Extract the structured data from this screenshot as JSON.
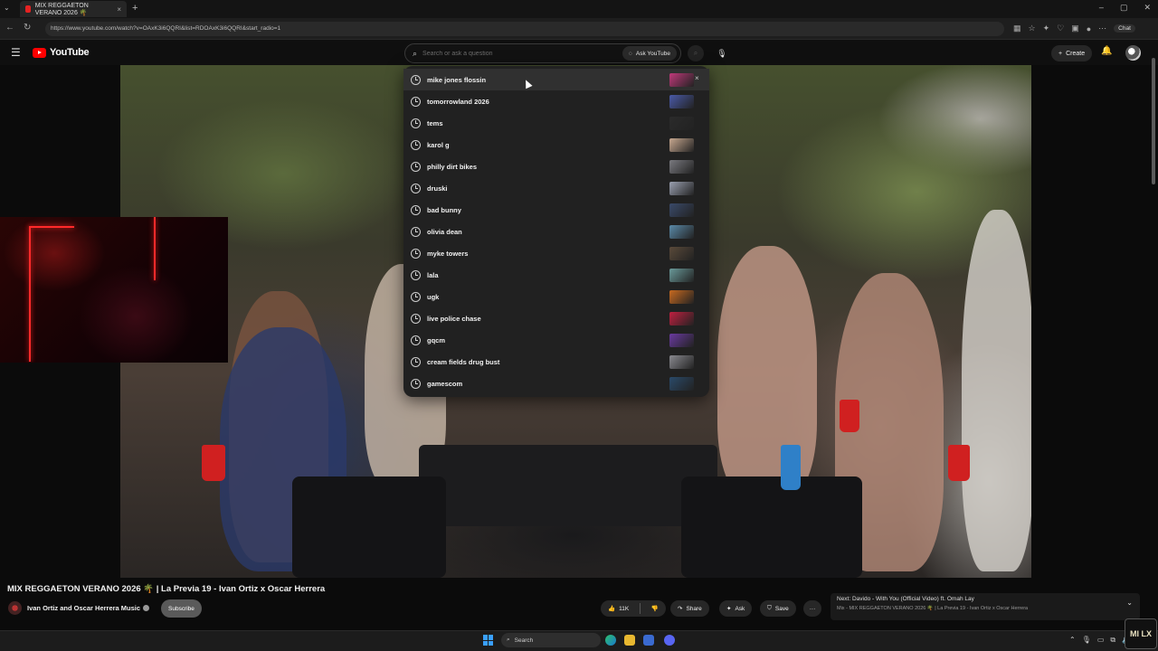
{
  "browser": {
    "tab_title": "MIX REGGAETON VERANO 2026 🌴",
    "tab_close": "×",
    "new_tab": "+",
    "url": "https://www.youtube.com/watch?v=OAxK3i6QQRI&list=RDOAxK3i6QQRI&start_radio=1",
    "chat_label": "Chat",
    "window_controls": [
      "–",
      "▢",
      "✕"
    ]
  },
  "youtube": {
    "logo_text": "YouTube",
    "search": {
      "placeholder": "Search or ask a question",
      "ask_label": "Ask YouTube"
    },
    "create_label": "Create",
    "suggestions": [
      {
        "text": "mike jones flossin",
        "thumb_color": "#c0397a"
      },
      {
        "text": "tomorrowland 2026",
        "thumb_color": "#4a5aa8"
      },
      {
        "text": "tems",
        "thumb_color": "#2b2b2b"
      },
      {
        "text": "karol g",
        "thumb_color": "#c8a890"
      },
      {
        "text": "philly dirt bikes",
        "thumb_color": "#7a7a80"
      },
      {
        "text": "druski",
        "thumb_color": "#9aa0b0"
      },
      {
        "text": "bad bunny",
        "thumb_color": "#3a4a6a"
      },
      {
        "text": "olivia dean",
        "thumb_color": "#5a8aa8"
      },
      {
        "text": "myke towers",
        "thumb_color": "#5a4a3a"
      },
      {
        "text": "lala",
        "thumb_color": "#6a9a9a"
      },
      {
        "text": "ugk",
        "thumb_color": "#c86a20"
      },
      {
        "text": "live police chase",
        "thumb_color": "#c02040"
      },
      {
        "text": "gqcm",
        "thumb_color": "#6a3aa0"
      },
      {
        "text": "cream fields drug bust",
        "thumb_color": "#8a8a90"
      },
      {
        "text": "gamescom",
        "thumb_color": "#2a4a6a"
      }
    ],
    "remove_glyph": "×",
    "video": {
      "title": "MIX REGGAETON VERANO 2026 🌴 | La Previa 19 - Ivan Ortiz x Oscar Herrera",
      "channel": "Ivan Ortiz and Oscar Herrera Music",
      "subscribe_label": "Subscribe",
      "likes": "11K",
      "share_label": "Share",
      "ask_label": "Ask",
      "save_label": "Save",
      "more_label": "···"
    },
    "next": {
      "line1": "Next: Davido - With You (Official Video) ft. Omah Lay",
      "line2": "Mix - MIX REGGAETON VERANO 2026 🌴 | La Previa 19 - Ivan Ortiz x Oscar Herrera"
    }
  },
  "taskbar": {
    "search_label": "Search",
    "corner_logo": "MI LX"
  },
  "colors": {
    "accent_red": "#ff0000",
    "dropdown_bg": "#212121",
    "page_bg": "#0f0f0f"
  }
}
